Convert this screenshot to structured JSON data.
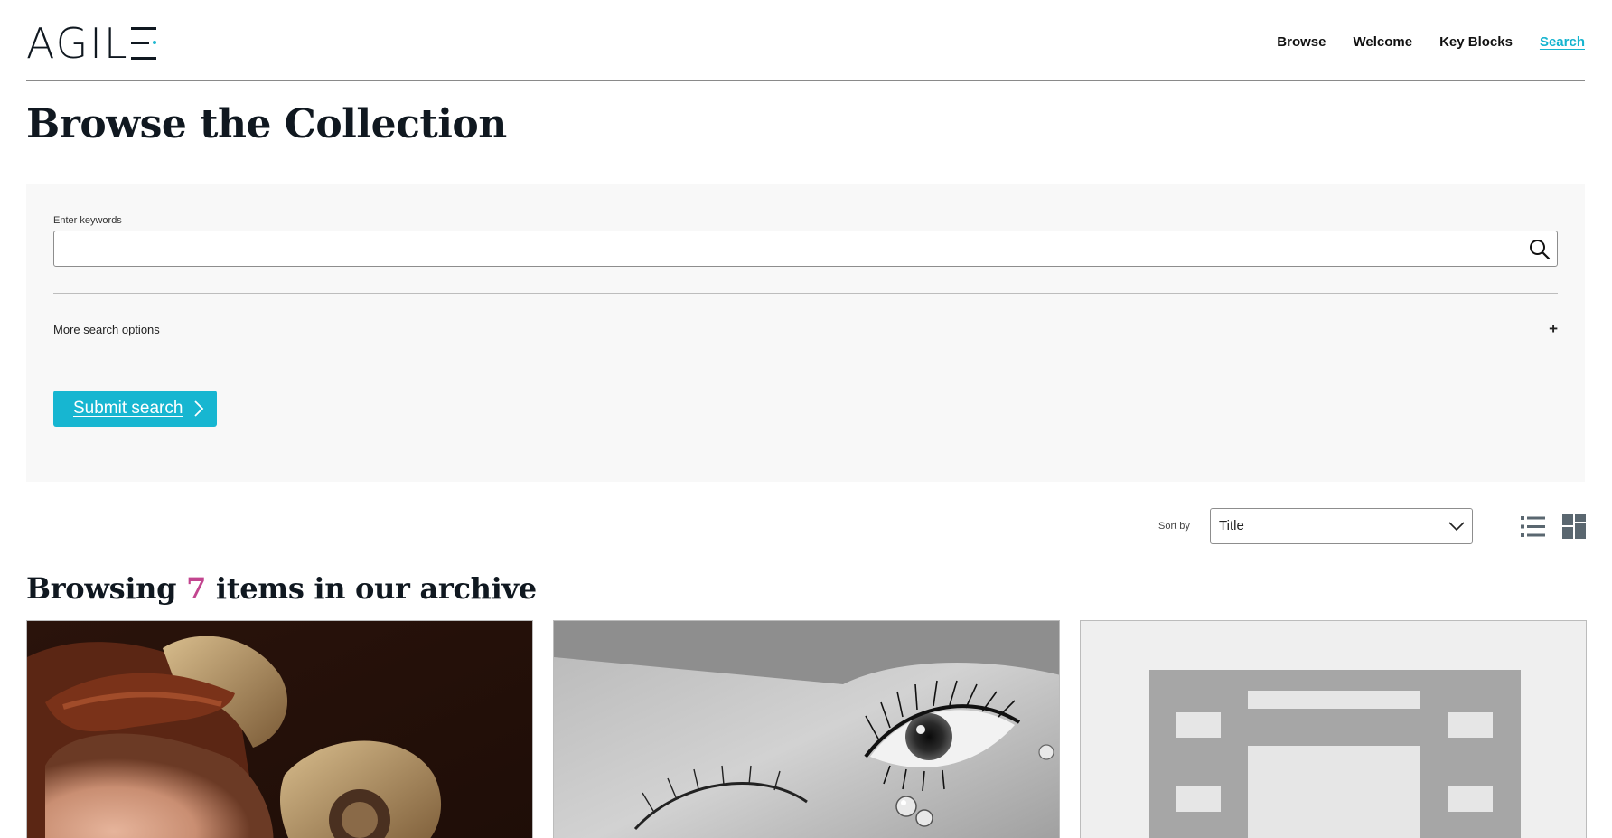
{
  "header": {
    "logo_text": "AGIL",
    "logo_alt": "AGILE",
    "nav": [
      {
        "label": "Browse",
        "active": false
      },
      {
        "label": "Welcome",
        "active": false
      },
      {
        "label": "Key Blocks",
        "active": false
      },
      {
        "label": "Search",
        "active": true
      }
    ]
  },
  "page_title": "Browse the Collection",
  "search": {
    "keywords_label": "Enter keywords",
    "keywords_value": "",
    "keywords_placeholder": "",
    "more_options_label": "More search options",
    "submit_label": "Submit search"
  },
  "sort": {
    "label": "Sort by",
    "selected": "Title"
  },
  "results": {
    "heading_prefix": "Browsing",
    "count": "7",
    "heading_suffix": "items in our archive"
  },
  "cards": [
    {
      "image": "painted portrait of a figure with ram horns and braided hair"
    },
    {
      "image": "black and white close-up photograph of an eye with glass tears"
    },
    {
      "image": "grey placeholder thumbnail for video item"
    }
  ],
  "icons": {
    "search": "search-icon",
    "plus": "plus-icon",
    "submit_arrow": "chevron-right-icon",
    "sort_arrow": "chevron-down-icon",
    "list_view": "list-view-icon",
    "grid_view": "grid-view-icon"
  },
  "colors": {
    "accent": "#17b6d1",
    "count_highlight": "#c2458f",
    "panel_bg": "#f8f8f8",
    "heading": "#101820"
  }
}
